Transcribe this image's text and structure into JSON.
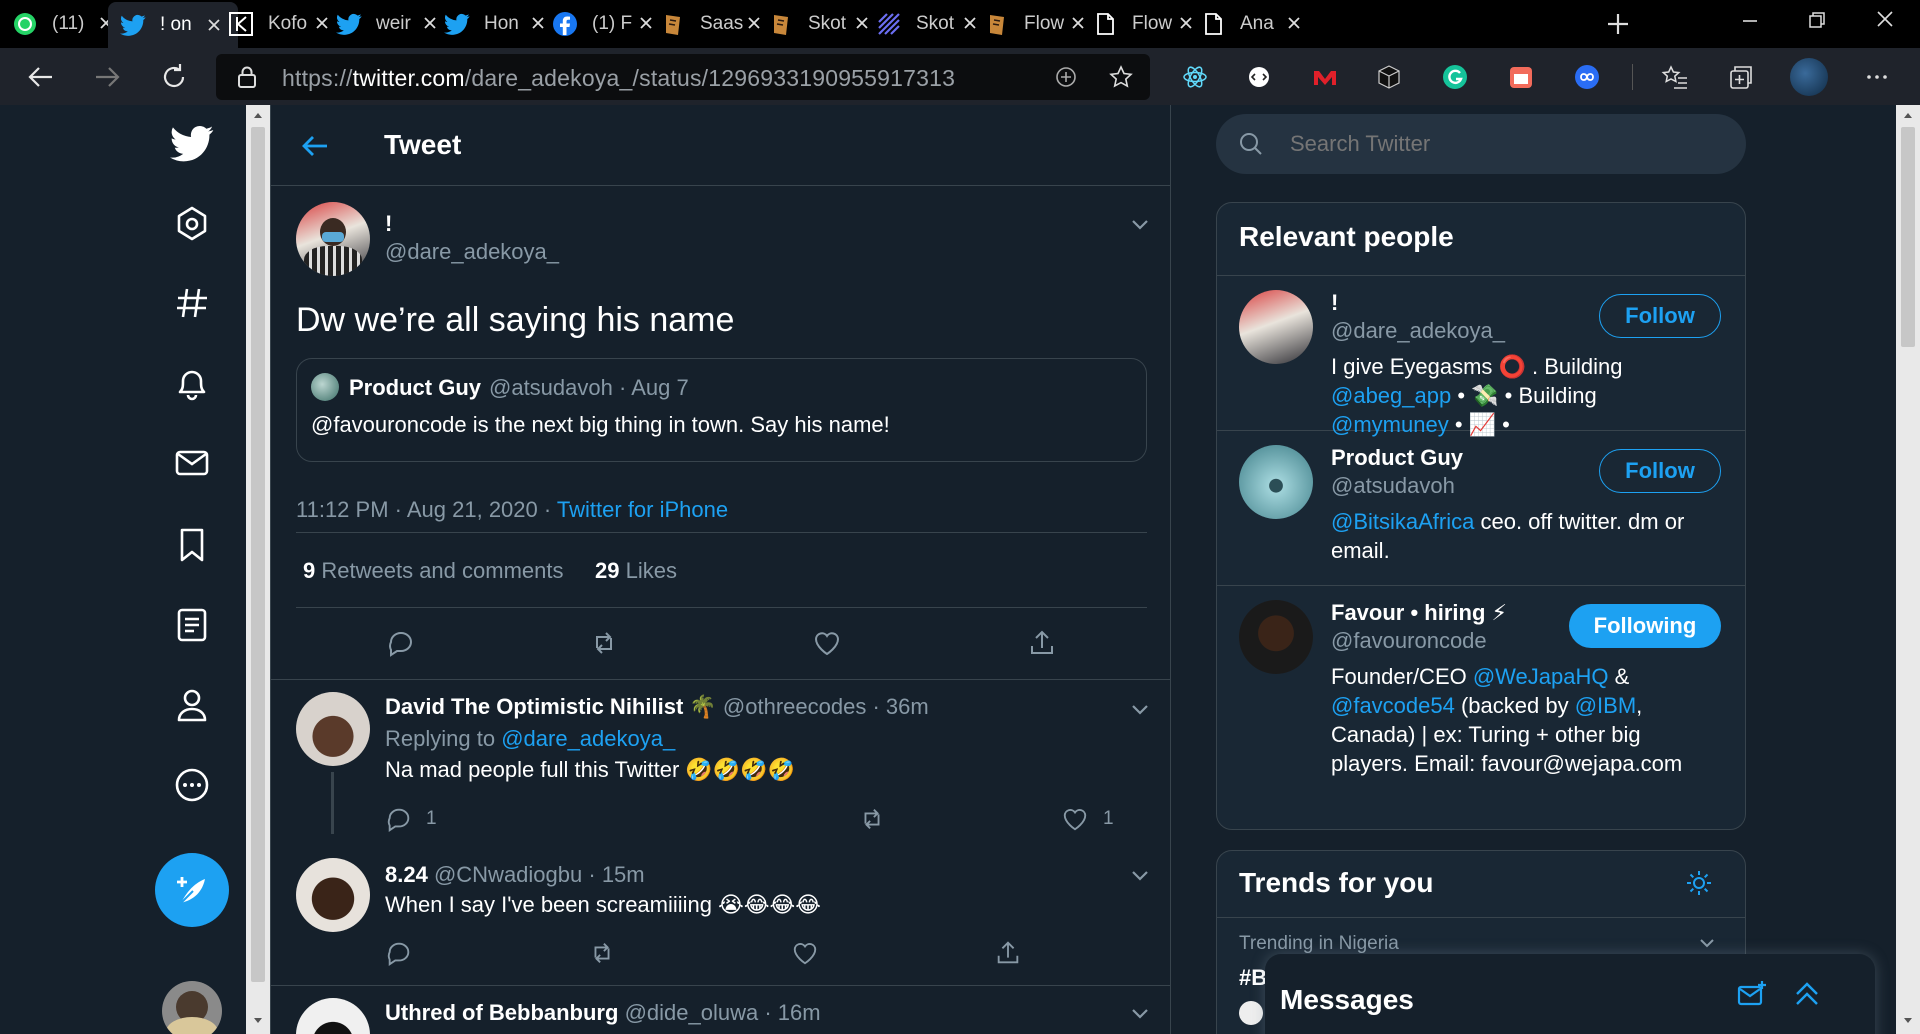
{
  "browser": {
    "tabs": [
      {
        "title": "(11)",
        "icon": "whatsapp-icon",
        "color": "#25d366"
      },
      {
        "title": "! on",
        "icon": "twitter-icon",
        "color": "#1da1f2"
      },
      {
        "title": "Kofo",
        "icon": "k-icon",
        "color": "#ffffff"
      },
      {
        "title": "weir",
        "icon": "twitter-icon",
        "color": "#1da1f2"
      },
      {
        "title": "Hon",
        "icon": "twitter-icon",
        "color": "#1da1f2"
      },
      {
        "title": "(1) F",
        "icon": "facebook-icon",
        "color": "#1877f2"
      },
      {
        "title": "Saas",
        "icon": "doc-app-icon",
        "color": "#c8873a"
      },
      {
        "title": "Skot",
        "icon": "doc-app-icon",
        "color": "#c8873a"
      },
      {
        "title": "Skot",
        "icon": "stripes-icon",
        "color": "#6b6ef2"
      },
      {
        "title": "Flow",
        "icon": "doc-app-icon",
        "color": "#c8873a"
      },
      {
        "title": "Flow",
        "icon": "page-icon",
        "color": "#ffffff"
      },
      {
        "title": "Ana",
        "icon": "page-icon",
        "color": "#ffffff"
      }
    ],
    "url_scheme": "https://",
    "url_domain": "twitter.com",
    "url_path": "/dare_adekoya_/status/1296933190955917313"
  },
  "header": {
    "title": "Tweet"
  },
  "tweet": {
    "display_name": "!",
    "handle": "@dare_adekoya_",
    "text": "Dw we’re all saying his name",
    "quote": {
      "name": "Product Guy",
      "handle": "@atsudavoh",
      "date": "· Aug 7",
      "text": "@favouroncode is the next big thing in town. Say his name!"
    },
    "timestamp": "11:12 PM · Aug 21, 2020 ·",
    "source": "Twitter for iPhone",
    "retweets_count": "9",
    "retweets_label": "Retweets and comments",
    "likes_count": "29",
    "likes_label": "Likes"
  },
  "replies": [
    {
      "name": "David The Optimistic Nihilist 🌴",
      "handle": "@othreecodes",
      "time": "· 36m",
      "replying_prefix": "Replying to",
      "replying_to": "@dare_adekoya_",
      "text": "Na mad people full this Twitter 🤣🤣🤣🤣",
      "reply_count": "1",
      "like_count": "1"
    },
    {
      "name": "8.24",
      "handle": "@CNwadiogbu",
      "time": "· 15m",
      "text": "When I say I've been screamiiiing 😭😂😂😂"
    },
    {
      "name": "Uthred of Bebbanburg",
      "handle": "@dide_oluwa",
      "time": "· 16m"
    }
  ],
  "search": {
    "placeholder": "Search Twitter"
  },
  "relevant": {
    "title": "Relevant people",
    "people": [
      {
        "name": "!",
        "handle": "@dare_adekoya_",
        "button": "Follow",
        "bio": [
          [
            {
              "t": "I give Eyegasms ⭕ . Building"
            }
          ],
          [
            {
              "t": "@abeg_app",
              "link": true
            },
            {
              "t": " • 💸 • Building"
            }
          ],
          [
            {
              "t": "@mymuney",
              "link": true
            },
            {
              "t": " • 📈 •"
            }
          ]
        ]
      },
      {
        "name": "Product Guy",
        "handle": "@atsudavoh",
        "button": "Follow",
        "bio": [
          [
            {
              "t": "@BitsikaAfrica",
              "link": true
            },
            {
              "t": " ceo. off twitter. dm or"
            }
          ],
          [
            {
              "t": "email."
            }
          ]
        ]
      },
      {
        "name": "Favour • hiring ⚡",
        "handle": "@favouroncode",
        "button": "Following",
        "bio": [
          [
            {
              "t": "Founder/CEO "
            },
            {
              "t": "@WeJapaHQ",
              "link": true
            },
            {
              "t": " &"
            }
          ],
          [
            {
              "t": "@favcode54",
              "link": true
            },
            {
              "t": " (backed by "
            },
            {
              "t": "@IBM",
              "link": true
            },
            {
              "t": ","
            }
          ],
          [
            {
              "t": "Canada) | ex: Turing + other big"
            }
          ],
          [
            {
              "t": "players. Email: favour@wejapa.com"
            }
          ]
        ]
      }
    ]
  },
  "trends": {
    "title": "Trends for you",
    "first_context": "Trending in Nigeria",
    "first_tag": "#B"
  },
  "messages": {
    "title": "Messages"
  },
  "colors": {
    "accent": "#1da1f2",
    "bg": "#15202b",
    "card": "#192734",
    "border": "#38444d",
    "muted": "#8899a6"
  }
}
